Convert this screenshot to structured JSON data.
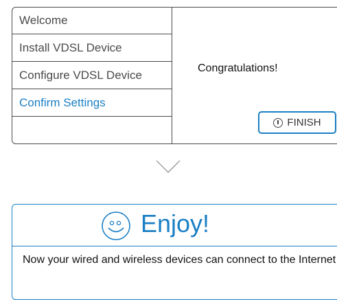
{
  "wizard": {
    "steps": [
      {
        "label": "Welcome"
      },
      {
        "label": "Install VDSL Device"
      },
      {
        "label": "Configure VDSL Device"
      },
      {
        "label": "Confirm Settings",
        "active": true
      }
    ],
    "message": "Congratulations!",
    "finish_label": "FINISH",
    "accent_color": "#1a7fc4"
  },
  "enjoy": {
    "title": "Enjoy!",
    "message": "Now your wired and wireless devices can connect to the Internet !",
    "icon": "smiley-icon"
  }
}
